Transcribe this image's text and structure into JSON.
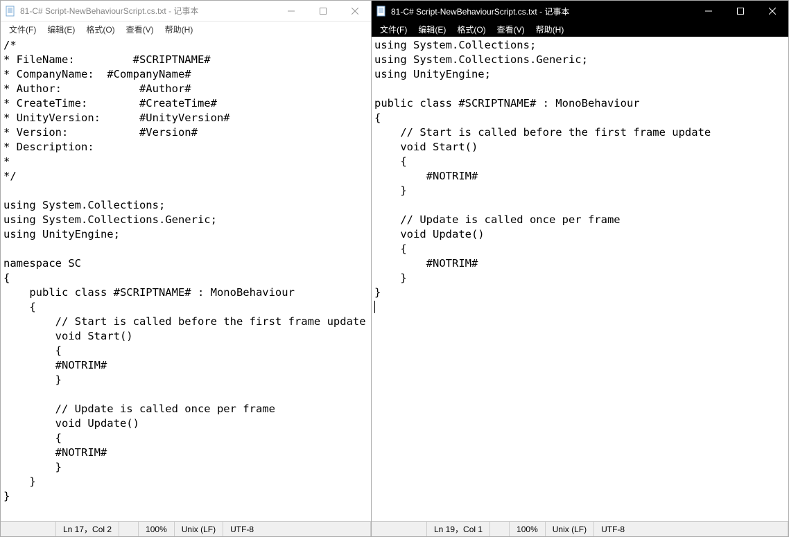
{
  "left": {
    "title": "81-C# Script-NewBehaviourScript.cs.txt - 记事本",
    "menus": {
      "file": "文件(F)",
      "edit": "编辑(E)",
      "format": "格式(O)",
      "view": "查看(V)",
      "help": "帮助(H)"
    },
    "content": "/*\n* FileName:         #SCRIPTNAME#\n* CompanyName:  #CompanyName#\n* Author:            #Author#\n* CreateTime:        #CreateTime#\n* UnityVersion:      #UnityVersion#\n* Version:           #Version#\n* Description:\n*\n*/\n\nusing System.Collections;\nusing System.Collections.Generic;\nusing UnityEngine;\n\nnamespace SC\n{\n    public class #SCRIPTNAME# : MonoBehaviour\n    {\n        // Start is called before the first frame update\n        void Start()\n        {\n        #NOTRIM#\n        }\n\n        // Update is called once per frame\n        void Update()\n        {\n        #NOTRIM#\n        }\n    }\n}",
    "status": {
      "pos": "Ln 17，Col 2",
      "zoom": "100%",
      "eol": "Unix (LF)",
      "encoding": "UTF-8"
    }
  },
  "right": {
    "title": "81-C# Script-NewBehaviourScript.cs.txt - 记事本",
    "menus": {
      "file": "文件(F)",
      "edit": "编辑(E)",
      "format": "格式(O)",
      "view": "查看(V)",
      "help": "帮助(H)"
    },
    "content": "using System.Collections;\nusing System.Collections.Generic;\nusing UnityEngine;\n\npublic class #SCRIPTNAME# : MonoBehaviour\n{\n    // Start is called before the first frame update\n    void Start()\n    {\n        #NOTRIM#\n    }\n\n    // Update is called once per frame\n    void Update()\n    {\n        #NOTRIM#\n    }\n}",
    "status": {
      "pos": "Ln 19，Col 1",
      "zoom": "100%",
      "eol": "Unix (LF)",
      "encoding": "UTF-8"
    }
  }
}
